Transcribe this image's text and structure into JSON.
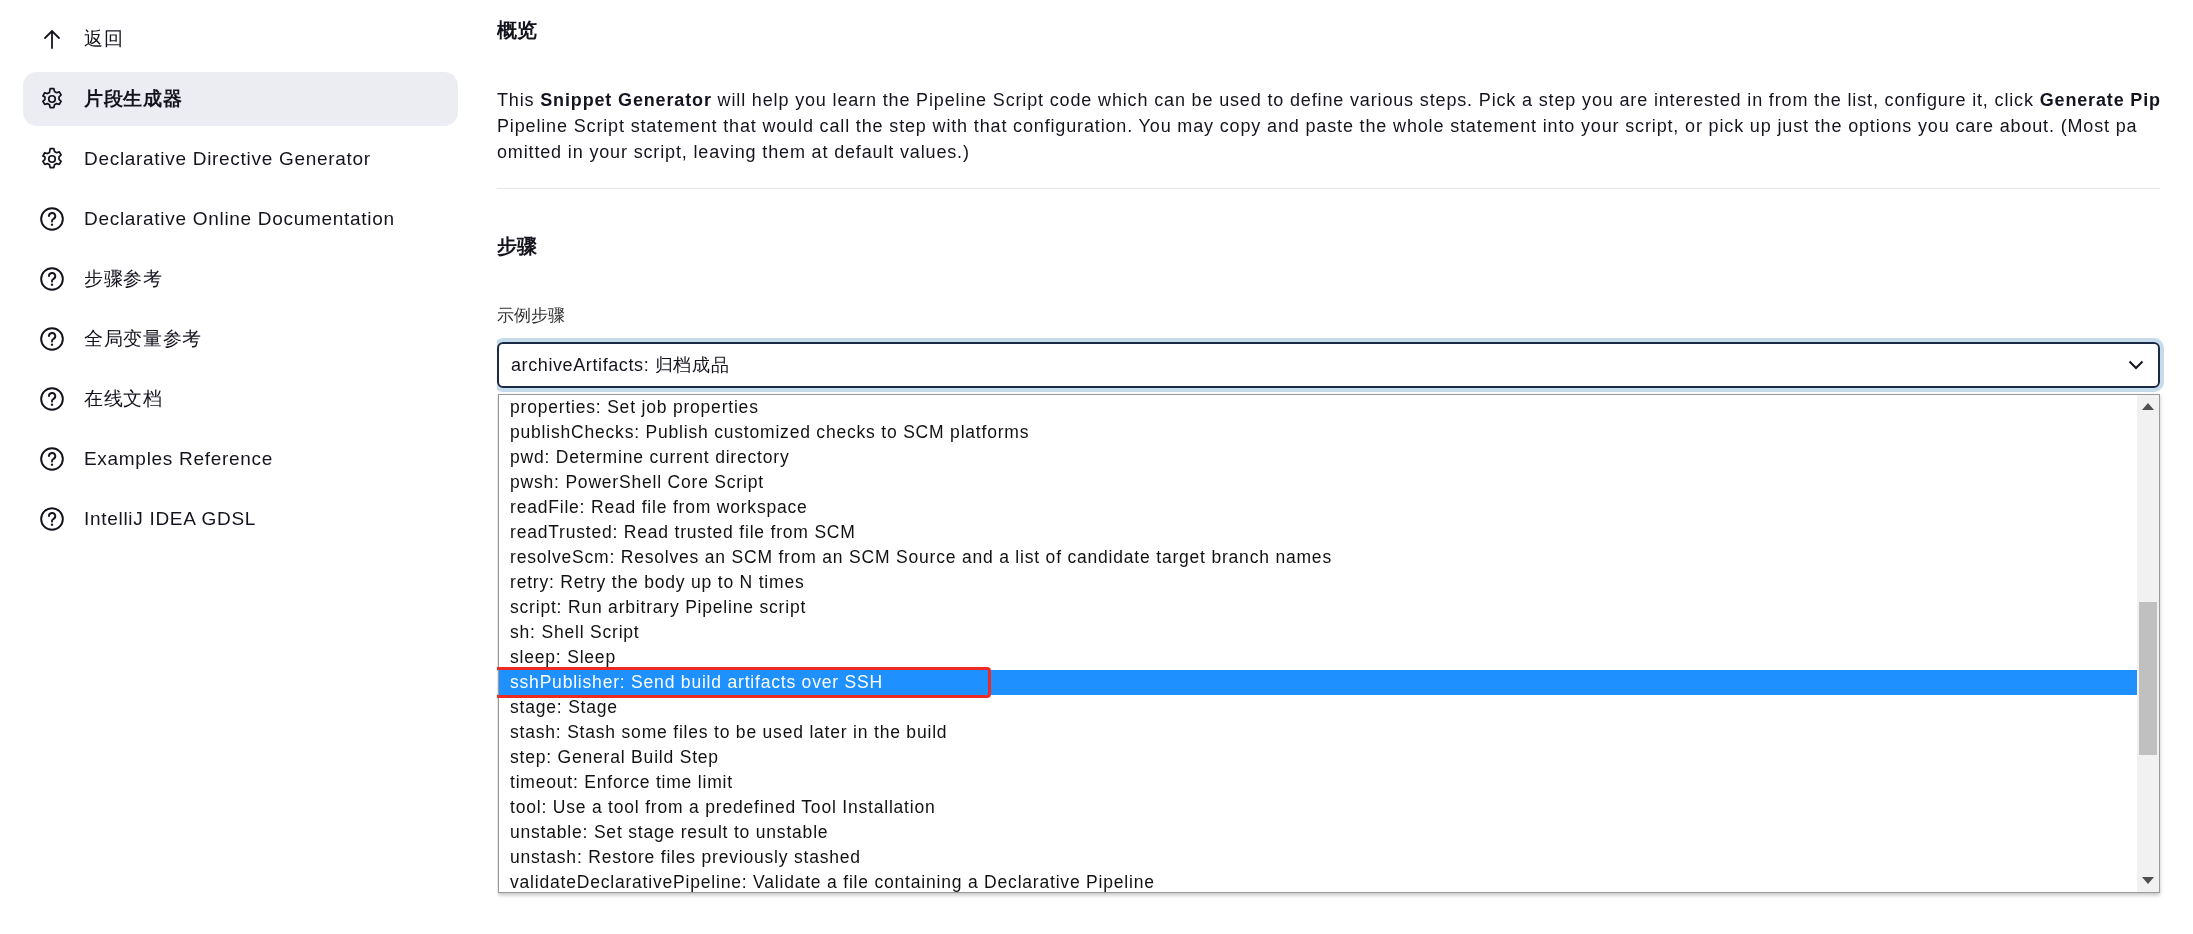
{
  "sidebar": {
    "items": [
      {
        "kind": "back",
        "label": "返回",
        "selected": false
      },
      {
        "kind": "gear",
        "label": "片段生成器",
        "selected": true
      },
      {
        "kind": "gear",
        "label": "Declarative Directive Generator",
        "selected": false
      },
      {
        "kind": "help",
        "label": "Declarative Online Documentation",
        "selected": false
      },
      {
        "kind": "help",
        "label": "步骤参考",
        "selected": false
      },
      {
        "kind": "help",
        "label": "全局变量参考",
        "selected": false
      },
      {
        "kind": "help",
        "label": "在线文档",
        "selected": false
      },
      {
        "kind": "help",
        "label": "Examples Reference",
        "selected": false
      },
      {
        "kind": "help",
        "label": "IntelliJ IDEA GDSL",
        "selected": false
      }
    ]
  },
  "overview": {
    "title": "概览",
    "description_lines": [
      "This **Snippet Generator** will help you learn the Pipeline Script code which can be used to define various steps. Pick a step you are interested in from the list, configure it, click **Generate Pip**",
      "Pipeline Script statement that would call the step with that configuration. You may copy and paste the whole statement into your script, or pick up just the options you care about. (Most pa",
      "omitted in your script, leaving them at default values.)"
    ]
  },
  "steps": {
    "title": "步骤",
    "field_label": "示例步骤",
    "select": {
      "value": "archiveArtifacts: 归档成品",
      "expanded": true,
      "options": [
        {
          "label": "properties: Set job properties",
          "selected": false
        },
        {
          "label": "publishChecks: Publish customized checks to SCM platforms",
          "selected": false
        },
        {
          "label": "pwd: Determine current directory",
          "selected": false
        },
        {
          "label": "pwsh: PowerShell Core Script",
          "selected": false
        },
        {
          "label": "readFile: Read file from workspace",
          "selected": false
        },
        {
          "label": "readTrusted: Read trusted file from SCM",
          "selected": false
        },
        {
          "label": "resolveScm: Resolves an SCM from an SCM Source and a list of candidate target branch names",
          "selected": false
        },
        {
          "label": "retry: Retry the body up to N times",
          "selected": false
        },
        {
          "label": "script: Run arbitrary Pipeline script",
          "selected": false
        },
        {
          "label": "sh: Shell Script",
          "selected": false
        },
        {
          "label": "sleep: Sleep",
          "selected": false
        },
        {
          "label": "sshPublisher: Send build artifacts over SSH",
          "selected": true
        },
        {
          "label": "stage: Stage",
          "selected": false
        },
        {
          "label": "stash: Stash some files to be used later in the build",
          "selected": false
        },
        {
          "label": "step: General Build Step",
          "selected": false
        },
        {
          "label": "timeout: Enforce time limit",
          "selected": false
        },
        {
          "label": "tool: Use a tool from a predefined Tool Installation",
          "selected": false
        },
        {
          "label": "unstable: Set stage result to unstable",
          "selected": false
        },
        {
          "label": "unstash: Restore files previously stashed",
          "selected": false
        },
        {
          "label": "validateDeclarativePipeline: Validate a file containing a Declarative Pipeline",
          "selected": false
        }
      ]
    },
    "highlight": {
      "kind": "frame"
    }
  }
}
